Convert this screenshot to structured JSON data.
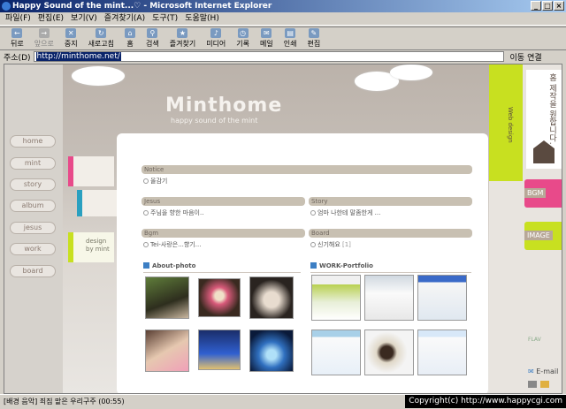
{
  "window": {
    "title": "Happy Sound of the mint...♡ - Microsoft Internet Explorer",
    "min": "_",
    "max": "□",
    "close": "×"
  },
  "menu": [
    "파일(F)",
    "편집(E)",
    "보기(V)",
    "즐겨찾기(A)",
    "도구(T)",
    "도움말(H)"
  ],
  "toolbar": [
    {
      "label": "뒤로",
      "icon": "back-arrow-icon",
      "enabled": true
    },
    {
      "label": "앞으로",
      "icon": "forward-arrow-icon",
      "enabled": false
    },
    {
      "label": "중지",
      "icon": "stop-icon",
      "enabled": true
    },
    {
      "label": "새로고침",
      "icon": "refresh-icon",
      "enabled": true
    },
    {
      "label": "홈",
      "icon": "home-icon",
      "enabled": true
    },
    {
      "label": "검색",
      "icon": "search-icon",
      "enabled": true
    },
    {
      "label": "즐겨찾기",
      "icon": "favorites-icon",
      "enabled": true
    },
    {
      "label": "미디어",
      "icon": "media-icon",
      "enabled": true
    },
    {
      "label": "기록",
      "icon": "history-icon",
      "enabled": true
    },
    {
      "label": "메일",
      "icon": "mail-icon",
      "enabled": true
    },
    {
      "label": "인쇄",
      "icon": "print-icon",
      "enabled": true
    },
    {
      "label": "편집",
      "icon": "edit-icon",
      "enabled": true
    }
  ],
  "address": {
    "label": "주소(D)",
    "url": "http://minthome.net/",
    "go": "이동",
    "links": "연결"
  },
  "site": {
    "title": "Minthome",
    "subtitle": "happy sound of the mint",
    "nav": [
      "home",
      "mint",
      "story",
      "album",
      "jesus",
      "work",
      "board"
    ],
    "design_note_1": "design",
    "design_note_2": "by mint",
    "sections": {
      "notice": {
        "header": "Notice",
        "item": "올감기"
      },
      "jesus": {
        "header": "Jesus",
        "item": "주님을 향한 마음이.."
      },
      "story": {
        "header": "Story",
        "item": "엄마 나한테 말좀한게 ..."
      },
      "bgm": {
        "header": "Bgm",
        "item": "Tei-사랑은...향기..."
      },
      "board": {
        "header": "Board",
        "item": "신기해요",
        "count": "[1]"
      }
    },
    "about_photo": "About-photo",
    "work_portfolio": "WORK-Portfolio",
    "right": {
      "vertical_text": "홈 제작을 원합니다.",
      "web_design": "Web design",
      "bgm": "BGM",
      "image": "IMAGE",
      "flash": "FLAV",
      "email": "E-mail"
    },
    "colors": {
      "pink": "#e84a8a",
      "teal": "#2aa0c0",
      "lime": "#c8e020",
      "brown": "#5a4a40"
    }
  },
  "status": {
    "text": "[배경 음악] 죄짐 맡은 우리구주 (00:55)",
    "copyright": "Copyright(c) http://www.happycgi.com"
  }
}
